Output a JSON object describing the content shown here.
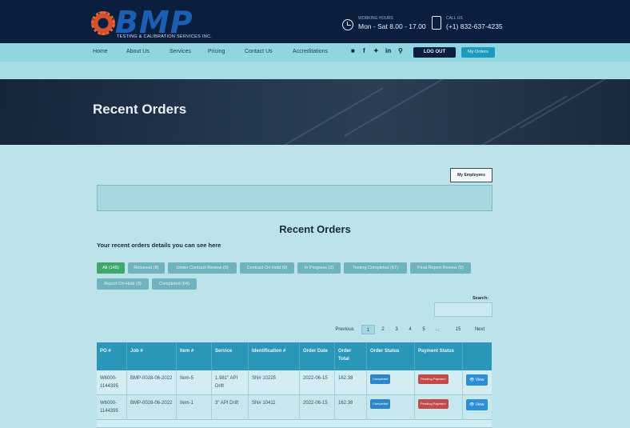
{
  "brand": {
    "logo_text": "BMP",
    "tagline": "TESTING & CALIBRATION SERVICES INC."
  },
  "header": {
    "hours_label": "WORKING HOURS",
    "hours_value": "Mon - Sat 8.00 - 17.00",
    "call_label": "CALL US",
    "call_value": "(+1) 832-637-4235"
  },
  "nav": {
    "items": [
      "Home",
      "About Us",
      "Services",
      "Pricing",
      "Contact Us",
      "Accreditations"
    ],
    "social": [
      "f",
      "✔",
      "in",
      "⌕"
    ],
    "logout": "LOG OUT",
    "my_orders": "My Orders"
  },
  "hero": {
    "title": "Recent Orders"
  },
  "page": {
    "my_employees": "My Employees",
    "heading": "Recent Orders",
    "subheading": "Your recent orders details you can see here",
    "search_label": "Search:"
  },
  "filters": [
    "All (145)",
    "Recieved (8)",
    "Under Contract Review (0)",
    "Contract On Hold (0)",
    "In Progress (3)",
    "Testing Completed (67)",
    "Final Report Review (0)",
    "Report On Hold (3)",
    "Completed (64)"
  ],
  "pagination": [
    "Previous",
    "1",
    "2",
    "3",
    "4",
    "5",
    "...",
    "15",
    "Next"
  ],
  "table": {
    "headers": [
      "PO #",
      "Job #",
      "Item #",
      "Service",
      "Identification #",
      "Order Date",
      "Order Total",
      "Order Status",
      "Payment Status",
      ""
    ],
    "rows": [
      [
        "W6000-1144395",
        "BMP-0028-06-2022",
        "Item-5",
        "1.981\" API Drift",
        "SN# 10225",
        "2022-06-15",
        "162.38",
        "Completed",
        "Pending Payment",
        "View"
      ],
      [
        "W6000-1144395",
        "BMP-0028-06-2022",
        "Item-1",
        "3\" API Drift",
        "SN# 10411",
        "2022-06-15",
        "162.38",
        "Completed",
        "Pending Payment",
        "View"
      ]
    ]
  },
  "colors": {
    "topbar": "#0b1e3d",
    "nav": "#8fd6e0",
    "content_bg": "#bde3ea",
    "table_header": "#2a97b9",
    "active_filter": "#3ea96a"
  }
}
